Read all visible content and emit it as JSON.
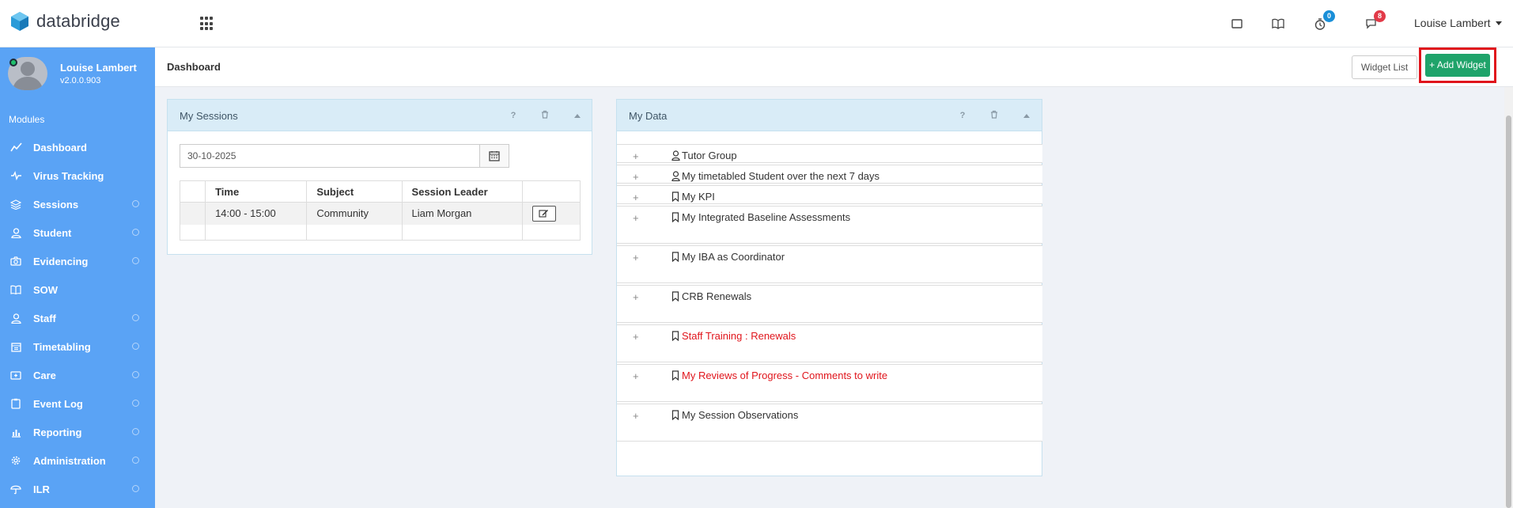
{
  "app": {
    "brand": "databridge"
  },
  "topbar": {
    "timer_badge": "0",
    "messages_badge": "8",
    "user_name": "Louise Lambert"
  },
  "sidebar": {
    "profile_name": "Louise Lambert",
    "version": "v2.0.0.903",
    "modules_label": "Modules",
    "items": [
      {
        "label": "Dashboard",
        "icon": "chart-line-icon",
        "has_children": false
      },
      {
        "label": "Virus Tracking",
        "icon": "pulse-icon",
        "has_children": false
      },
      {
        "label": "Sessions",
        "icon": "layers-icon",
        "has_children": true
      },
      {
        "label": "Student",
        "icon": "user-icon",
        "has_children": true
      },
      {
        "label": "Evidencing",
        "icon": "camera-icon",
        "has_children": true
      },
      {
        "label": "SOW",
        "icon": "book-icon",
        "has_children": false
      },
      {
        "label": "Staff",
        "icon": "user-icon",
        "has_children": true
      },
      {
        "label": "Timetabling",
        "icon": "calendar-icon",
        "has_children": true
      },
      {
        "label": "Care",
        "icon": "first-aid-icon",
        "has_children": true
      },
      {
        "label": "Event Log",
        "icon": "clipboard-icon",
        "has_children": true
      },
      {
        "label": "Reporting",
        "icon": "bar-chart-icon",
        "has_children": true
      },
      {
        "label": "Administration",
        "icon": "gear-icon",
        "has_children": true
      },
      {
        "label": "ILR",
        "icon": "umbrella-icon",
        "has_children": true
      }
    ]
  },
  "header": {
    "title": "Dashboard",
    "widget_list_label": "Widget List",
    "add_widget_label": "+ Add Widget"
  },
  "sessions_widget": {
    "title": "My Sessions",
    "help": "?",
    "date_value": "30-10-2025",
    "columns": [
      "",
      "Time",
      "Subject",
      "Session Leader",
      ""
    ],
    "rows": [
      {
        "time": "14:00 - 15:00",
        "subject": "Community",
        "leader": "Liam Morgan"
      }
    ]
  },
  "data_widget": {
    "title": "My Data",
    "help": "?",
    "items": [
      {
        "label": "Tutor Group",
        "icon": "user-icon",
        "color": "#333333",
        "height": 24
      },
      {
        "label": "My timetabled Student over the next 7 days",
        "icon": "user-icon",
        "color": "#333333",
        "height": 24
      },
      {
        "label": "My KPI",
        "icon": "bookmark-icon",
        "color": "#333333",
        "height": 24
      },
      {
        "label": "My Integrated Baseline Assessments",
        "icon": "bookmark-icon",
        "color": "#333333",
        "height": 48
      },
      {
        "label": "My IBA as Coordinator",
        "icon": "bookmark-icon",
        "color": "#333333",
        "height": 48
      },
      {
        "label": "CRB Renewals",
        "icon": "bookmark-icon",
        "color": "#333333",
        "height": 48
      },
      {
        "label": "Staff Training : Renewals",
        "icon": "bookmark-icon",
        "color": "#e0151c",
        "height": 48
      },
      {
        "label": "My Reviews of Progress - Comments to write",
        "icon": "bookmark-icon",
        "color": "#e0151c",
        "height": 48
      },
      {
        "label": "My Session Observations",
        "icon": "bookmark-icon",
        "color": "#333333",
        "height": 48
      }
    ]
  },
  "colors": {
    "sidebar_bg": "#5aa3f5",
    "accent_green": "#1fa36a",
    "highlight_red": "#e0151c",
    "widget_header": "#d9ecf7"
  }
}
